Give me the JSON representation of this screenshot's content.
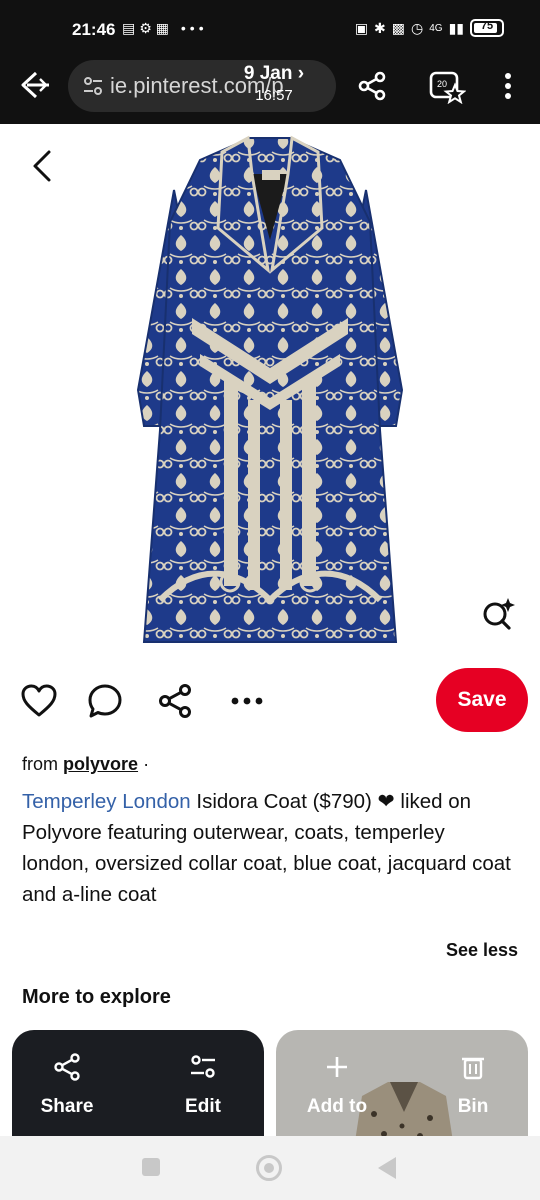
{
  "status_bar": {
    "time": "21:46",
    "left_icons": [
      "image-icon",
      "alarm-icon",
      "app-icon"
    ],
    "more": "•••",
    "network": "4G",
    "battery": "75"
  },
  "browser": {
    "url": "ie.pinterest.com/p",
    "date_overlay_line1": "9 Jan ›",
    "date_overlay_line2": "16:57",
    "tab_count": "20"
  },
  "pin": {
    "image_icon": "coat-image",
    "actions": {
      "save_label": "Save"
    },
    "from_prefix": "from",
    "source": "polyvore",
    "separator": "·",
    "description_link": "Temperley London",
    "description_text": " Isidora Coat ($790) ❤ liked on Polyvore featuring outerwear, coats, temperley london, oversized collar coat, blue coat, jacquard coat and a-line coat",
    "see_less": "See less",
    "more_to_explore": "More to explore"
  },
  "tray": {
    "share_label": "Share",
    "edit_label": "Edit",
    "add_label": "Add to",
    "bin_label": "Bin"
  },
  "colors": {
    "save_red": "#e60023",
    "link_blue": "#3461a8",
    "coat_blue": "#1e3a8a",
    "coat_pattern": "#d9d2c0"
  }
}
